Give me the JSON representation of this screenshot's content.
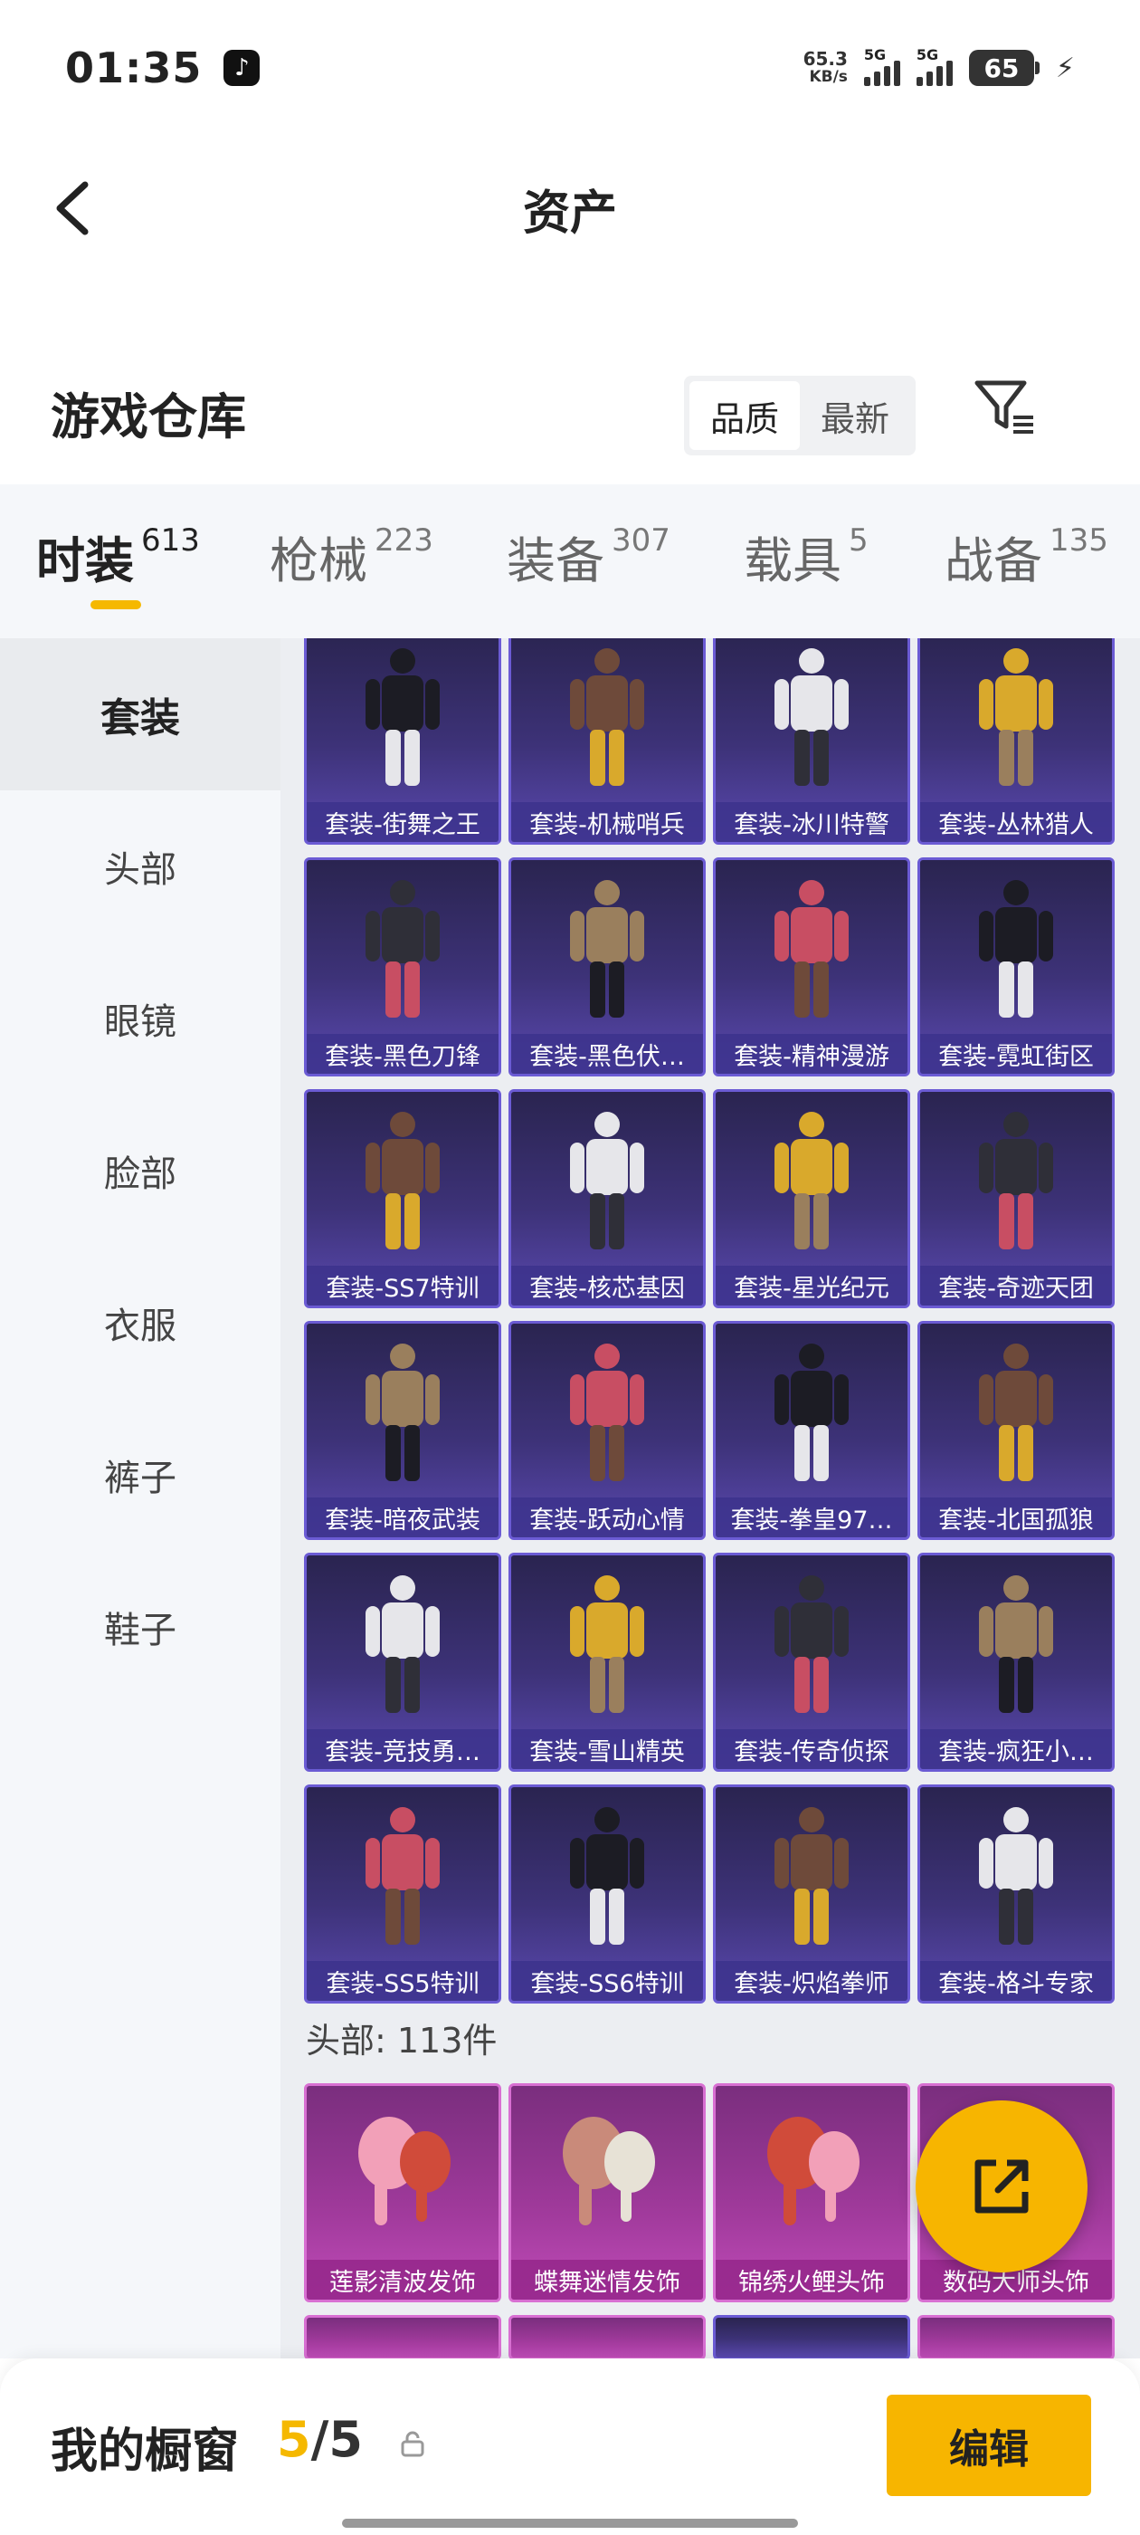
{
  "status": {
    "time": "01:35",
    "app_icon": "tiktok-icon",
    "net_speed": "65.3",
    "net_unit": "KB/s",
    "signal1": "5G",
    "signal2": "5G",
    "battery": "65"
  },
  "nav": {
    "title": "资产"
  },
  "warehouse": {
    "title": "游戏仓库",
    "sort_quality": "品质",
    "sort_latest": "最新"
  },
  "tabs": [
    {
      "label": "时装",
      "count": "613"
    },
    {
      "label": "枪械",
      "count": "223"
    },
    {
      "label": "装备",
      "count": "307"
    },
    {
      "label": "载具",
      "count": "5"
    },
    {
      "label": "战备",
      "count": "135"
    }
  ],
  "sidebar": [
    "套装",
    "头部",
    "眼镜",
    "脸部",
    "衣服",
    "裤子",
    "鞋子"
  ],
  "suits": [
    "套装-街舞之王",
    "套装-机械哨兵",
    "套装-冰川特警",
    "套装-丛林猎人",
    "套装-黑色刀锋",
    "套装-黑色伏…",
    "套装-精神漫游",
    "套装-霓虹街区",
    "套装-SS7特训",
    "套装-核芯基因",
    "套装-星光纪元",
    "套装-奇迹天团",
    "套装-暗夜武装",
    "套装-跃动心情",
    "套装-拳皇97…",
    "套装-北国孤狼",
    "套装-竞技勇…",
    "套装-雪山精英",
    "套装-传奇侦探",
    "套装-疯狂小…",
    "套装-SS5特训",
    "套装-SS6特训",
    "套装-炽焰拳师",
    "套装-格斗专家"
  ],
  "head_section": {
    "label": "头部: 113件"
  },
  "heads": [
    "莲影清波发饰",
    "蝶舞迷情发饰",
    "锦绣火鲤头饰",
    "数码大师头饰"
  ],
  "showcase": {
    "label": "我的橱窗",
    "current": "5",
    "slash": "/",
    "max": "5",
    "edit_label": "编辑"
  },
  "colors": {
    "accent": "#f7b500",
    "card_purple": "#3d3278",
    "card_pink": "#a13a9c"
  }
}
